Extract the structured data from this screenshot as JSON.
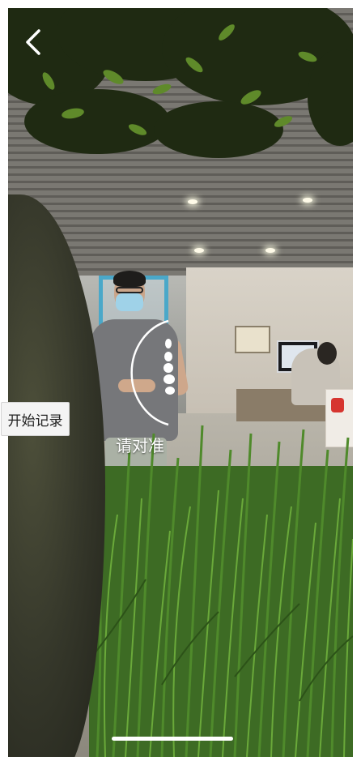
{
  "controls": {
    "back_icon": "chevron-left-icon",
    "start_record_label": "开始记录",
    "align_hint": "请对准"
  },
  "colors": {
    "overlay_text": "#ffffff",
    "button_bg": "#f4f4f4",
    "guide_stroke": "#ffffff"
  }
}
